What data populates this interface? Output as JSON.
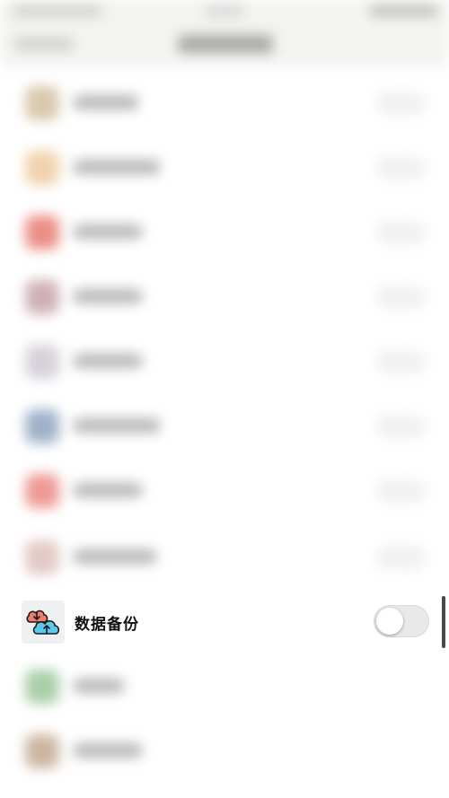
{
  "focused_item": {
    "label": "数据备份",
    "icon": "cloud-upload-icon",
    "toggle_on": false
  },
  "colors": {
    "cloud_red": "#f07c6d",
    "cloud_blue": "#5ec8ec",
    "outline": "#1b1b1b",
    "toggle_off": "#e9e9ea"
  }
}
